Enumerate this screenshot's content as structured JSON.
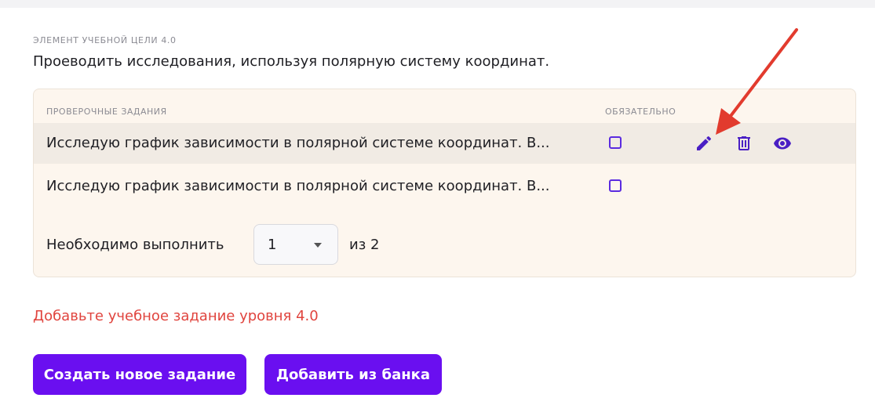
{
  "objective": {
    "eyebrow": "ЭЛЕМЕНТ УЧЕБНОЙ ЦЕЛИ 4.0",
    "text": "Проеводить исследования, используя полярную систему координат."
  },
  "tasks": {
    "header_tasks": "ПРОВЕРОЧНЫЕ ЗАДАНИЯ",
    "header_required": "ОБЯЗАТЕЛЬНО",
    "rows": [
      {
        "text": "Исследую график зависимости в полярной системе координат. В...",
        "required": false,
        "hovered": true
      },
      {
        "text": "Исследую график зависимости в полярной системе координат. В...",
        "required": false,
        "hovered": false
      }
    ],
    "required_label": "Необходимо выполнить",
    "required_count": "1",
    "of_total": "из 2"
  },
  "error_text": "Добавьте учебное задание уровня 4.0",
  "buttons": {
    "create": "Создать новое задание",
    "add_from_bank": "Добавить из банка"
  },
  "icons": {
    "edit": "pencil-icon",
    "delete": "trash-icon",
    "view": "eye-icon",
    "annotation": "red-arrow"
  },
  "colors": {
    "accent": "#6a0ff0",
    "icon": "#4a1fc4",
    "error": "#e0443e",
    "card_bg": "#fdf6ee",
    "annotation": "#e23b2e"
  }
}
